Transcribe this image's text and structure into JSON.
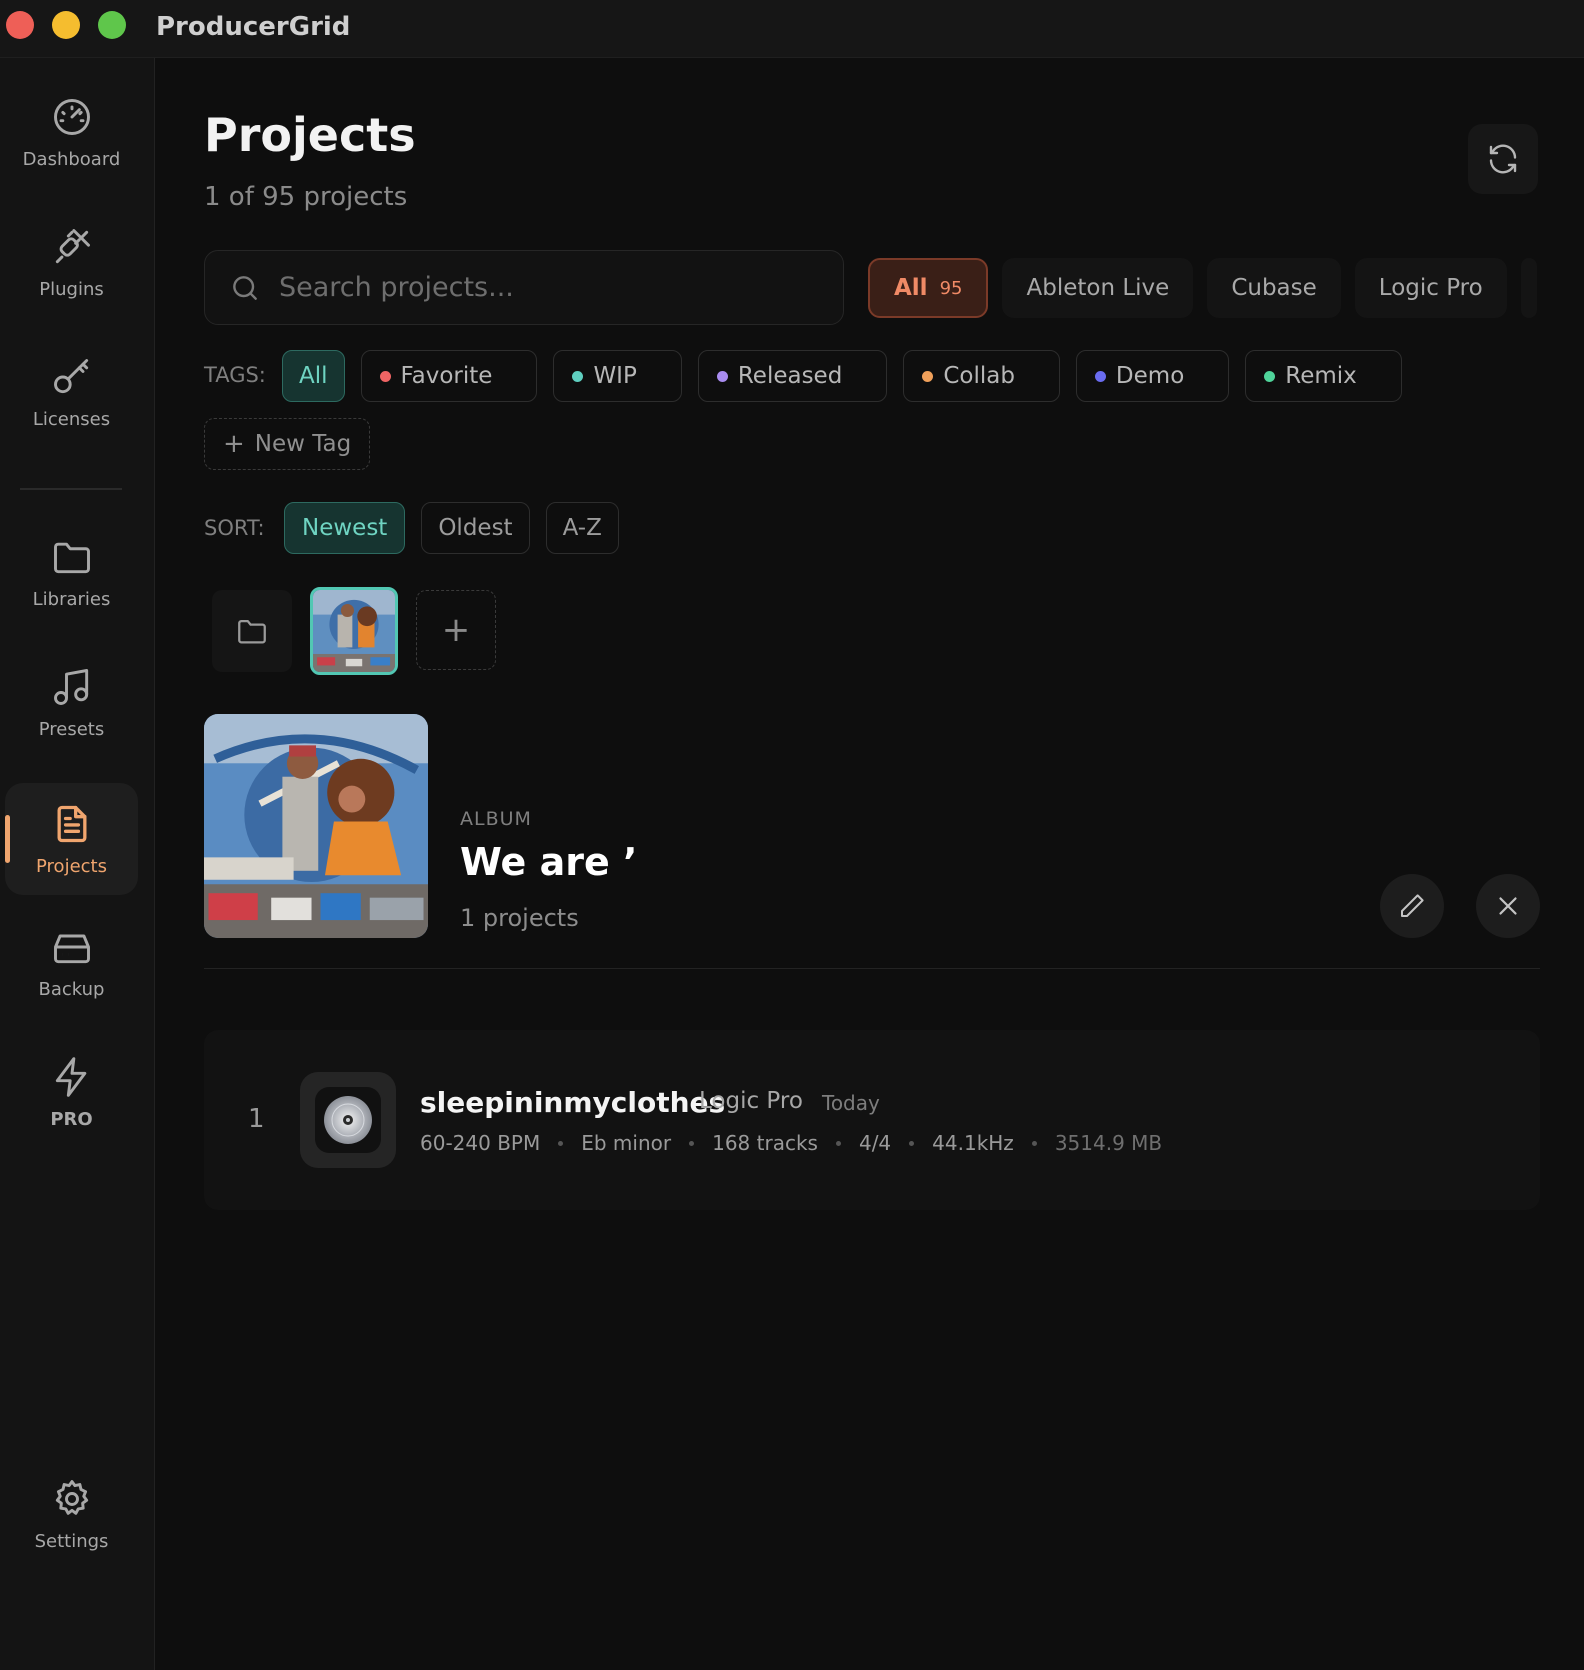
{
  "app": {
    "title": "ProducerGrid"
  },
  "sidebar": {
    "items": [
      {
        "label": "Dashboard",
        "icon": "gauge-icon"
      },
      {
        "label": "Plugins",
        "icon": "plug-icon"
      },
      {
        "label": "Licenses",
        "icon": "key-icon"
      },
      {
        "label": "Libraries",
        "icon": "folder-icon"
      },
      {
        "label": "Presets",
        "icon": "music-note-icon"
      },
      {
        "label": "Projects",
        "icon": "document-icon",
        "active": true
      },
      {
        "label": "Backup",
        "icon": "hard-drive-icon"
      },
      {
        "label": "PRO",
        "icon": "lightning-icon"
      },
      {
        "label": "Settings",
        "icon": "gear-icon"
      }
    ]
  },
  "header": {
    "title": "Projects",
    "subtitle": "1 of 95 projects"
  },
  "search": {
    "placeholder": "Search projects..."
  },
  "daw_filters": [
    {
      "label": "All",
      "count": "95",
      "active": true
    },
    {
      "label": "Ableton Live"
    },
    {
      "label": "Cubase"
    },
    {
      "label": "Logic Pro"
    }
  ],
  "tags": {
    "label": "TAGS:",
    "items": [
      {
        "label": "All",
        "active": true
      },
      {
        "label": "Favorite",
        "color": "#f06464"
      },
      {
        "label": "WIP",
        "color": "#5fcfc0"
      },
      {
        "label": "Released",
        "color": "#a98cf0"
      },
      {
        "label": "Collab",
        "color": "#f0a05a"
      },
      {
        "label": "Demo",
        "color": "#6a6cf0"
      },
      {
        "label": "Remix",
        "color": "#4fd49a"
      }
    ],
    "new_tag": "New Tag"
  },
  "sort": {
    "label": "SORT:",
    "options": [
      {
        "label": "Newest",
        "active": true
      },
      {
        "label": "Oldest"
      },
      {
        "label": "A-Z"
      }
    ]
  },
  "album": {
    "kind": "ALBUM",
    "name": "We are ’",
    "count": "1 projects"
  },
  "projects": [
    {
      "index": "1",
      "name": "sleepininmyclothes",
      "daw": "Logic Pro",
      "date": "Today",
      "bpm": "60-240 BPM",
      "key": "Eb minor",
      "tracks": "168 tracks",
      "time_signature": "4/4",
      "sample_rate": "44.1kHz",
      "size": "3514.9 MB"
    }
  ],
  "colors": {
    "accent_orange": "#f0a56e",
    "accent_teal": "#52c7b3",
    "active_filter": "#f08a66"
  }
}
